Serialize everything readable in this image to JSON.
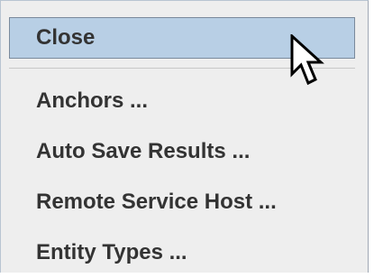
{
  "menu": {
    "items": [
      {
        "label": "Close",
        "selected": true
      },
      {
        "label": "Anchors ..."
      },
      {
        "label": "Auto Save Results ..."
      },
      {
        "label": "Remote Service Host ..."
      },
      {
        "label": "Entity Types ..."
      }
    ]
  },
  "cursor": {
    "icon": "arrow-pointer-icon"
  },
  "colors": {
    "menu_background": "#eeeeee",
    "selection_background": "#b8cfe5",
    "text": "#333333"
  }
}
